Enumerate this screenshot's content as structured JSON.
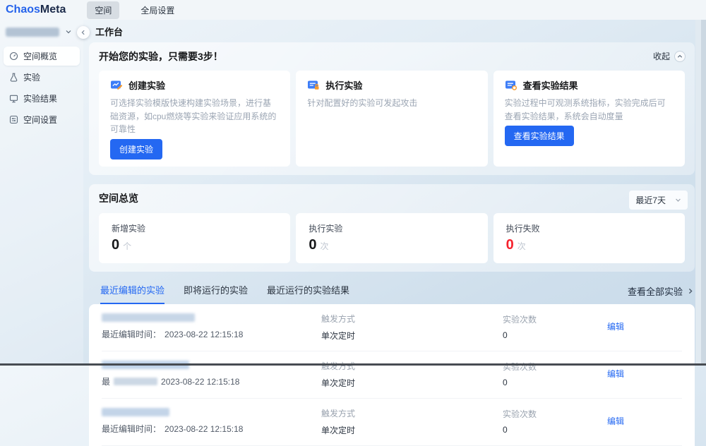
{
  "colors": {
    "accent": "#2468f2",
    "danger": "#f5222d"
  },
  "topbar": {
    "logo_part1": "Chaos",
    "logo_part2": "Meta",
    "tabs": [
      {
        "label": "空间",
        "active": true
      },
      {
        "label": "全局设置",
        "active": false
      }
    ]
  },
  "page": {
    "title": "工作台"
  },
  "sidebar": {
    "items": [
      {
        "label": "空间概览",
        "active": true
      },
      {
        "label": "实验",
        "active": false
      },
      {
        "label": "实验结果",
        "active": false
      },
      {
        "label": "空间设置",
        "active": false
      }
    ]
  },
  "guide": {
    "title": "开始您的实验，只需要3步！",
    "collapse_label": "收起",
    "steps": [
      {
        "title": "创建实验",
        "desc": "可选择实验模版快速构建实验场景，进行基础资源，如cpu燃烧等实验来验证应用系统的可靠性",
        "button": "创建实验"
      },
      {
        "title": "执行实验",
        "desc": "针对配置好的实验可发起攻击",
        "button": ""
      },
      {
        "title": "查看实验结果",
        "desc": "实验过程中可观测系统指标，实验完成后可查看实验结果，系统会自动度量",
        "button": "查看实验结果"
      }
    ]
  },
  "overview": {
    "title": "空间总览",
    "range_select": "最近7天",
    "stats": [
      {
        "label": "新增实验",
        "value": "0",
        "unit": "个"
      },
      {
        "label": "执行实验",
        "value": "0",
        "unit": "次"
      },
      {
        "label": "执行失败",
        "value": "0",
        "unit": "次"
      }
    ]
  },
  "experiments": {
    "tabs": [
      {
        "label": "最近编辑的实验",
        "active": true
      },
      {
        "label": "即将运行的实验",
        "active": false
      },
      {
        "label": "最近运行的实验结果",
        "active": false
      }
    ],
    "view_all_label": "查看全部实验",
    "labels": {
      "trigger": "触发方式",
      "count": "实验次数",
      "edit": "编辑"
    },
    "rows": [
      {
        "time_label": "最近编辑时间：",
        "time": "2023-08-22 12:15:18",
        "trigger_value": "单次定时",
        "count_value": "0"
      },
      {
        "time_label": "最",
        "time": "2023-08-22 12:15:18",
        "trigger_value": "单次定时",
        "count_value": "0"
      },
      {
        "time_label": "最近编辑时间：",
        "time": "2023-08-22 12:15:18",
        "trigger_value": "单次定时",
        "count_value": "0"
      }
    ]
  }
}
